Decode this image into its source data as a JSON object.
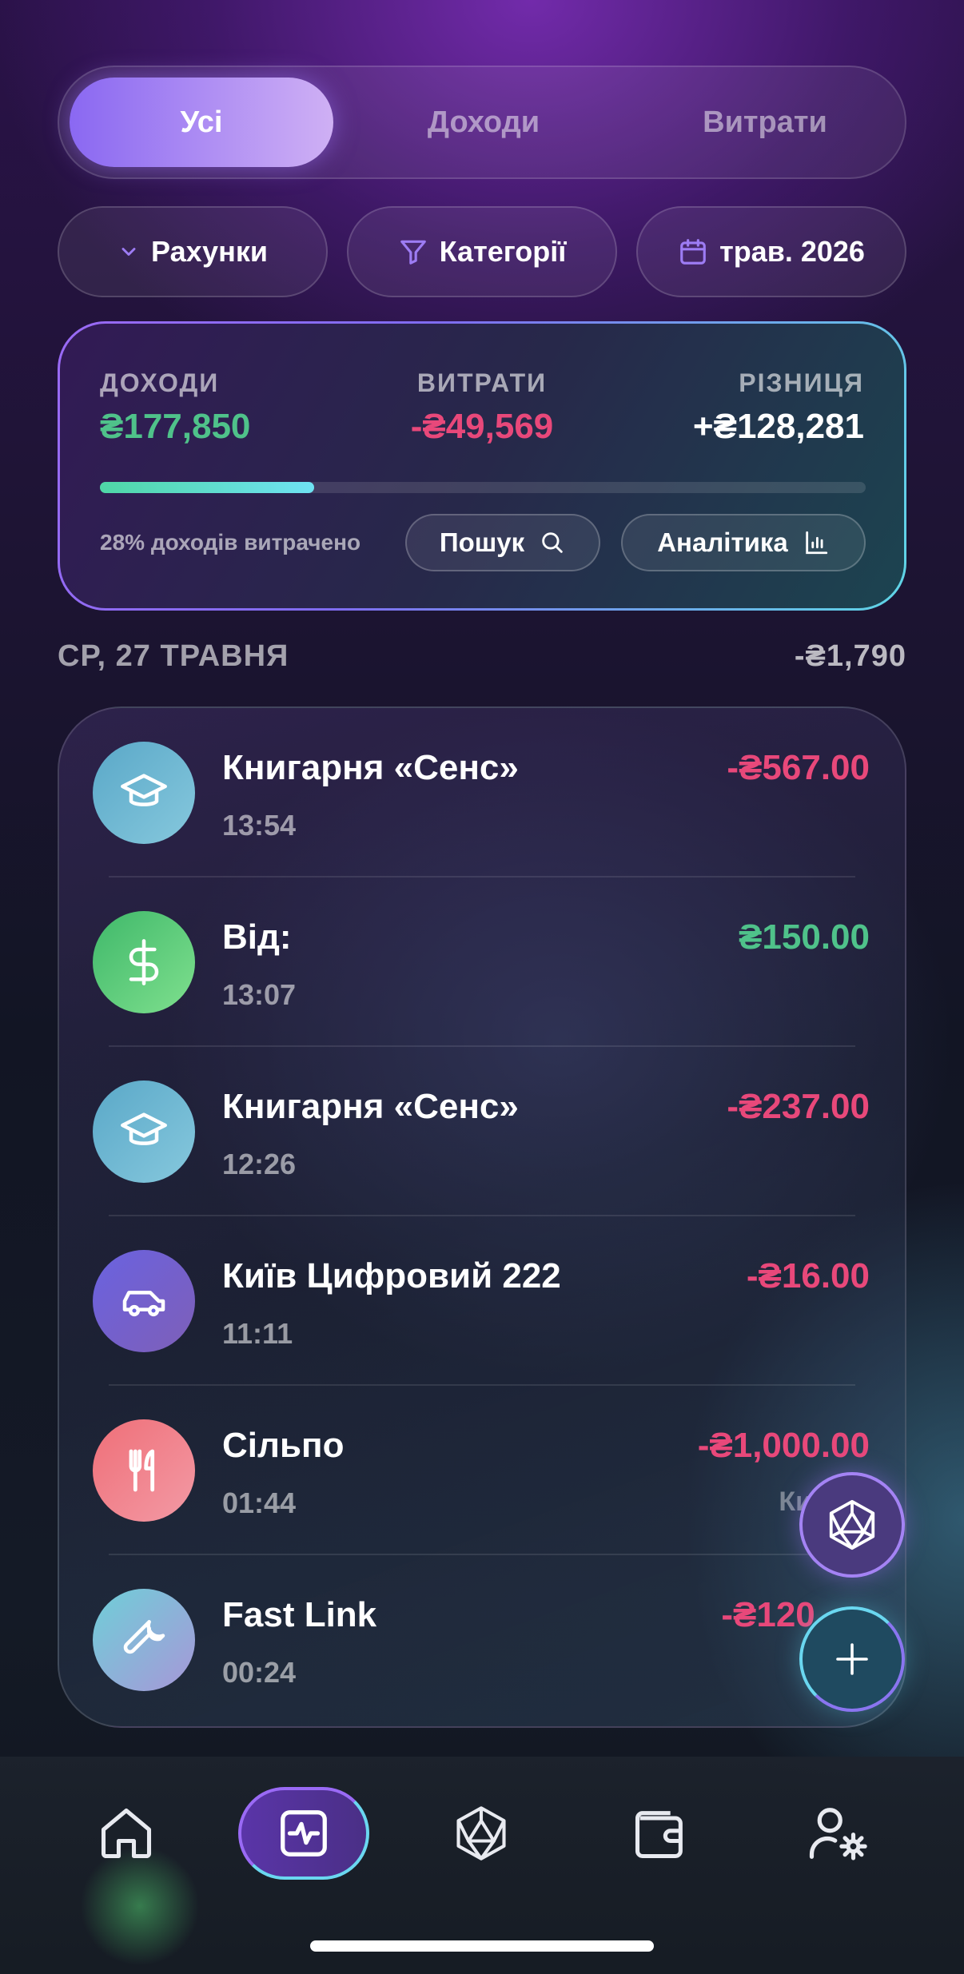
{
  "tabs": [
    {
      "label": "Усі",
      "active": true
    },
    {
      "label": "Доходи",
      "active": false
    },
    {
      "label": "Витрати",
      "active": false
    }
  ],
  "filters": {
    "accounts": "Рахунки",
    "categories": "Категорії",
    "period": "трав. 2026"
  },
  "summary": {
    "income_label": "ДОХОДИ",
    "income_value": "₴177,850",
    "expense_label": "ВИТРАТИ",
    "expense_value": "-₴49,569",
    "diff_label": "РІЗНИЦЯ",
    "diff_value": "+₴128,281",
    "spent_fraction": 0.28,
    "spent_text": "28% доходів витрачено",
    "search_label": "Пошук",
    "analytics_label": "Аналітика"
  },
  "day": {
    "date_label": "СР, 27 ТРАВНЯ",
    "total": "-₴1,790"
  },
  "transactions": [
    {
      "name": "Книгарня «Сенс»",
      "time": "13:54",
      "amount": "-₴567.00",
      "icon": "graduation-cap-icon",
      "type": "expense"
    },
    {
      "name": "Від:",
      "time": "13:07",
      "amount": "₴150.00",
      "icon": "dollar-icon",
      "type": "income"
    },
    {
      "name": "Книгарня «Сенс»",
      "time": "12:26",
      "amount": "-₴237.00",
      "icon": "graduation-cap-icon",
      "type": "expense"
    },
    {
      "name": "Київ Цифровий 222",
      "time": "11:11",
      "amount": "-₴16.00",
      "icon": "car-icon",
      "type": "expense"
    },
    {
      "name": "Сільпо",
      "time": "01:44",
      "amount": "-₴1,000.00",
      "sub": "Ки",
      "icon": "fork-knife-icon",
      "type": "expense"
    },
    {
      "name": "Fast Link",
      "time": "00:24",
      "amount": "-₴120.",
      "icon": "wrench-icon",
      "type": "expense"
    }
  ],
  "colors": {
    "accent": "#8a68f2",
    "income": "#4fc28a",
    "expense": "#e8487a",
    "teal": "#6ad7f0"
  },
  "nav": [
    "home-icon",
    "activity-icon",
    "ai-icon",
    "wallet-icon",
    "user-settings-icon"
  ]
}
